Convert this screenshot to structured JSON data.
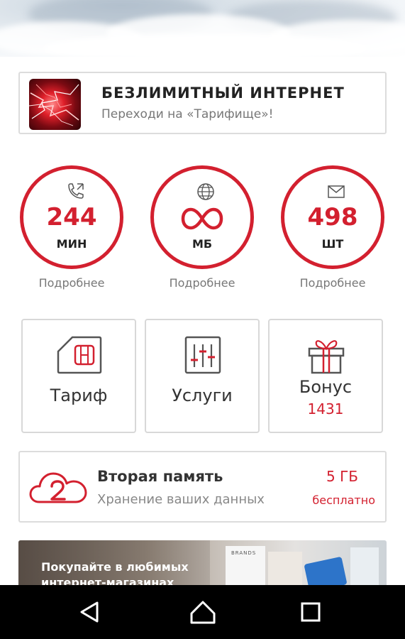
{
  "promo": {
    "title": "БЕЗЛИМИТНЫЙ ИНТЕРНЕТ",
    "subtitle": "Переходи на «Тарифище»!",
    "thumb": "lightning-thumbnail"
  },
  "balances": [
    {
      "icon": "phone-icon",
      "value": "244",
      "unit": "МИН",
      "more": "Подробнее"
    },
    {
      "icon": "globe-icon",
      "value": "∞",
      "unit": "МБ",
      "more": "Подробнее"
    },
    {
      "icon": "envelope-icon",
      "value": "498",
      "unit": "ШТ",
      "more": "Подробнее"
    }
  ],
  "tiles": [
    {
      "icon": "sim-card-icon",
      "label": "Тариф"
    },
    {
      "icon": "sliders-icon",
      "label": "Услуги"
    },
    {
      "icon": "gift-icon",
      "label": "Бонус",
      "sub": "1431"
    }
  ],
  "storage": {
    "icon": "cloud-2-icon",
    "title": "Вторая память",
    "subtitle": "Хранение ваших данных",
    "value": "5 ГБ",
    "price": "бесплатно"
  },
  "banner": {
    "text": "Покупайте в любимых интернет-магазинах",
    "brand": "BRANDS"
  },
  "navigation": {
    "back": "back-icon",
    "home": "home-icon",
    "recents": "recents-icon"
  },
  "colors": {
    "accent": "#d3202f",
    "border": "#dcdcdc",
    "text_muted": "#777777",
    "nav_bar": "#000000"
  }
}
